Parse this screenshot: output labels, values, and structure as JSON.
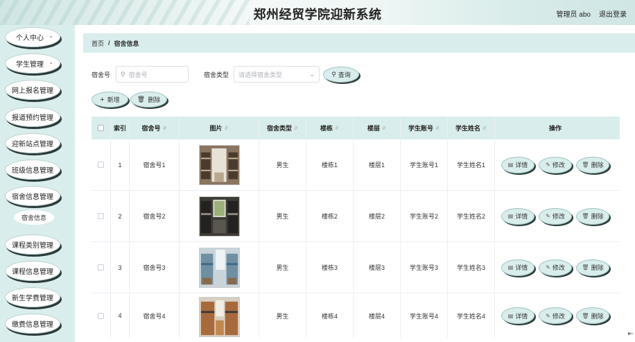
{
  "header": {
    "title": "郑州经贸学院迎新系统",
    "admin": "管理员 abo",
    "logout": "退出登录"
  },
  "sidebar": {
    "items": [
      {
        "label": "个人中心",
        "chevron": true
      },
      {
        "label": "学生管理",
        "chevron": true
      },
      {
        "label": "网上报名管理",
        "chevron": false
      },
      {
        "label": "报道预约管理",
        "chevron": false
      },
      {
        "label": "迎新站点管理",
        "chevron": false
      },
      {
        "label": "班级信息管理",
        "chevron": false
      },
      {
        "label": "宿舍信息管理",
        "chevron": false
      },
      {
        "label": "课程类别管理",
        "chevron": false
      },
      {
        "label": "课程信息管理",
        "chevron": false
      },
      {
        "label": "新生学费管理",
        "chevron": false
      },
      {
        "label": "缴费信息管理",
        "chevron": false
      }
    ],
    "sub_item": "宿舍信息"
  },
  "breadcrumb": {
    "home": "首页",
    "separator": "/",
    "current": "宿舍信息"
  },
  "search": {
    "dorm_label": "宿舍号",
    "dorm_placeholder": "宿舍号",
    "type_label": "宿舍类型",
    "type_placeholder": "请选择宿舍类型",
    "query_button": "查询"
  },
  "actions": {
    "add": "新增",
    "delete": "删除"
  },
  "table": {
    "headers": [
      "索引",
      "宿舍号",
      "图片",
      "宿舍类型",
      "楼栋",
      "楼层",
      "学生账号",
      "学生姓名",
      "操作"
    ],
    "row_buttons": {
      "detail": "详情",
      "edit": "修改",
      "delete": "删除"
    },
    "rows": [
      {
        "index": "1",
        "dorm": "宿舍号1",
        "type": "男生",
        "building": "楼栋1",
        "floor": "楼层1",
        "account": "学生账号1",
        "name": "学生姓名1"
      },
      {
        "index": "2",
        "dorm": "宿舍号2",
        "type": "男生",
        "building": "楼栋2",
        "floor": "楼层2",
        "account": "学生账号2",
        "name": "学生姓名2"
      },
      {
        "index": "3",
        "dorm": "宿舍号3",
        "type": "男生",
        "building": "楼栋3",
        "floor": "楼层3",
        "account": "学生账号3",
        "name": "学生姓名3"
      },
      {
        "index": "4",
        "dorm": "宿舍号4",
        "type": "男生",
        "building": "楼栋4",
        "floor": "楼层4",
        "account": "学生账号4",
        "name": "学生姓名4"
      }
    ]
  },
  "colors": {
    "accent": "#d9eeec",
    "shadow": "#2b3a3a"
  }
}
